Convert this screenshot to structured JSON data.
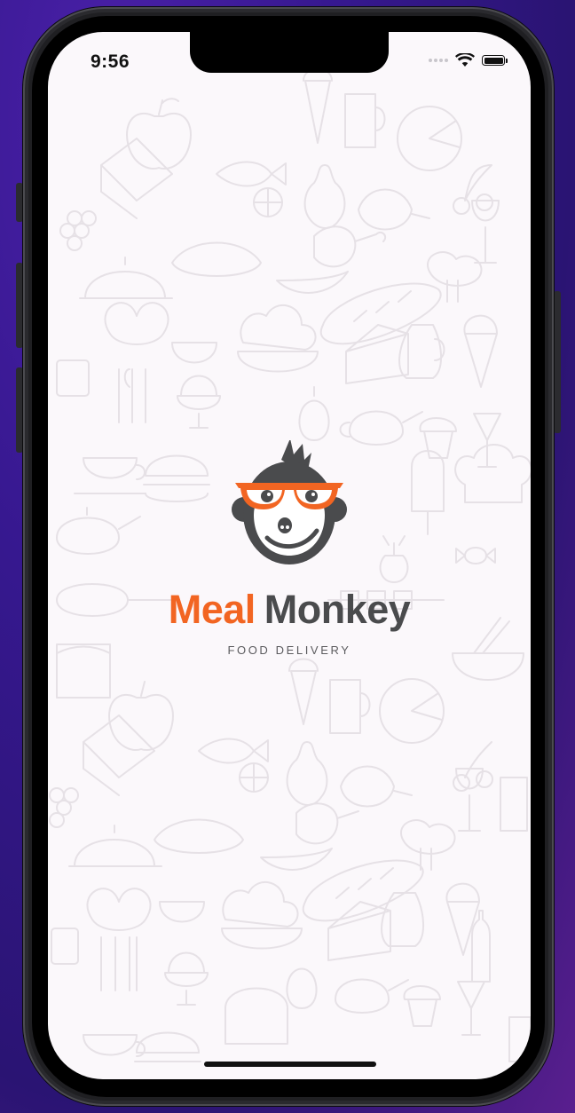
{
  "status_bar": {
    "time": "9:56",
    "icons": [
      "cellular-signal-icon",
      "wifi-icon",
      "battery-icon"
    ]
  },
  "splash": {
    "logo_icon": "monkey-with-glasses-icon",
    "brand_first": "Meal",
    "brand_second": "Monkey",
    "tagline": "FOOD DELIVERY"
  },
  "background": {
    "pattern": "food-doodles-pattern"
  },
  "colors": {
    "brand_orange": "#f26522",
    "brand_dark": "#4a4b4d",
    "screen_background": "#fbf8fb",
    "doodle_line": "#e6e1e6"
  }
}
